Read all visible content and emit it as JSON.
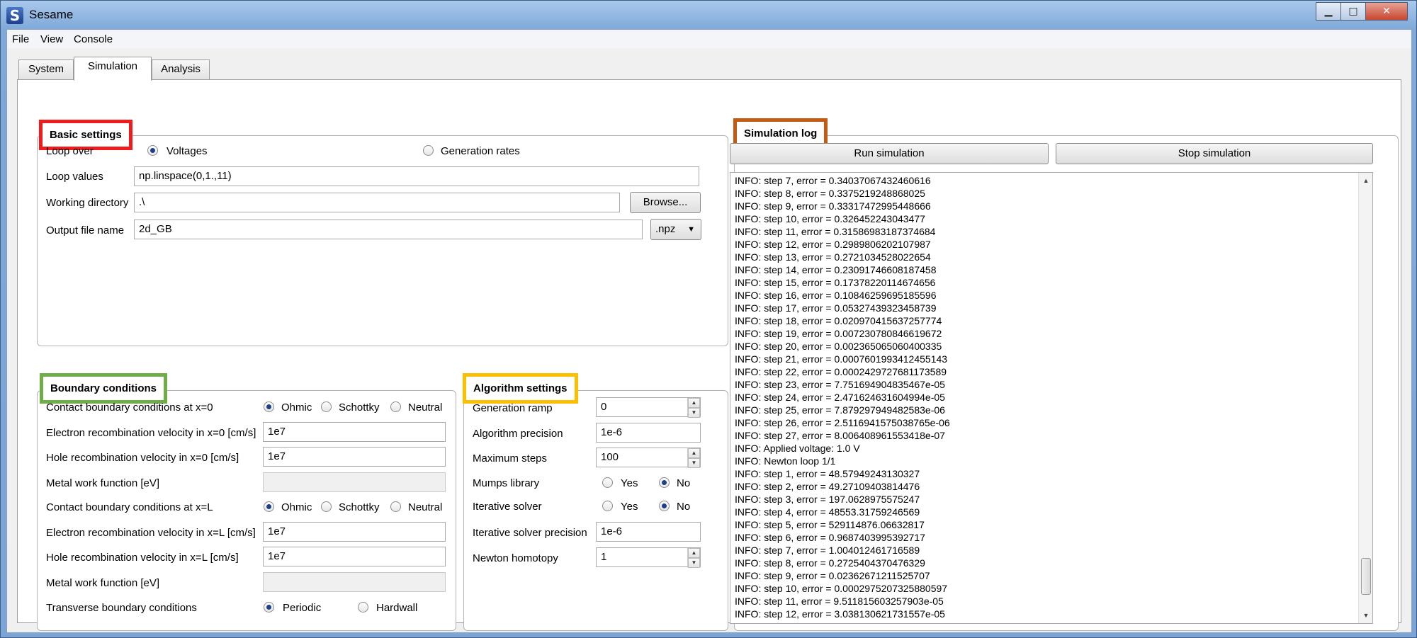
{
  "window": {
    "title": "Sesame",
    "icon_letter": "S",
    "minimize": "▁",
    "maximize": "□",
    "close": "✕"
  },
  "menu": [
    "File",
    "View",
    "Console"
  ],
  "tabs": [
    "System",
    "Simulation",
    "Analysis"
  ],
  "basic": {
    "title": "Basic settings",
    "loop_over": "Loop over",
    "opt_voltages": "Voltages",
    "opt_generation": "Generation rates",
    "loop_values_label": "Loop values",
    "loop_values": "np.linspace(0,1.,11)",
    "workdir_label": "Working directory",
    "workdir": ".\\",
    "browse": "Browse...",
    "output_label": "Output file name",
    "output": "2d_GB",
    "ext": ".npz"
  },
  "boundary": {
    "title": "Boundary conditions",
    "contact0": "Contact boundary conditions at x=0",
    "ohmic": "Ohmic",
    "schottky": "Schottky",
    "neutral": "Neutral",
    "erv0_label": "Electron recombination velocity in x=0 [cm/s]",
    "erv0": "1e7",
    "hrv0_label": "Hole recombination velocity in x=0 [cm/s]",
    "hrv0": "1e7",
    "metal_label": "Metal work function [eV]",
    "contactL": "Contact boundary conditions at x=L",
    "ervL_label": "Electron recombination velocity in x=L [cm/s]",
    "ervL": "1e7",
    "hrvL_label": "Hole recombination velocity in x=L [cm/s]",
    "hrvL": "1e7",
    "transverse": "Transverse boundary conditions",
    "periodic": "Periodic",
    "hardwall": "Hardwall"
  },
  "algorithm": {
    "title": "Algorithm settings",
    "gen_ramp_label": "Generation ramp",
    "gen_ramp": "0",
    "precision_label": "Algorithm precision",
    "precision": "1e-6",
    "max_steps_label": "Maximum steps",
    "max_steps": "100",
    "mumps_label": "Mumps library",
    "iter_label": "Iterative solver",
    "yes": "Yes",
    "no": "No",
    "iter_prec_label": "Iterative solver precision",
    "iter_prec": "1e-6",
    "homotopy_label": "Newton homotopy",
    "homotopy": "1"
  },
  "log": {
    "title": "Simulation log",
    "run": "Run simulation",
    "stop": "Stop simulation",
    "lines": [
      "INFO: step 7, error = 0.34037067432460616",
      "INFO: step 8, error = 0.3375219248868025",
      "INFO: step 9, error = 0.33317472995448666",
      "INFO: step 10, error = 0.326452243043477",
      "INFO: step 11, error = 0.31586983187374684",
      "INFO: step 12, error = 0.2989806202107987",
      "INFO: step 13, error = 0.2721034528022654",
      "INFO: step 14, error = 0.23091746608187458",
      "INFO: step 15, error = 0.17378220114674656",
      "INFO: step 16, error = 0.10846259695185596",
      "INFO: step 17, error = 0.05327439323458739",
      "INFO: step 18, error = 0.020970415637257774",
      "INFO: step 19, error = 0.007230780846619672",
      "INFO: step 20, error = 0.002365065060400335",
      "INFO: step 21, error = 0.0007601993412455143",
      "INFO: step 22, error = 0.0002429727681173589",
      "INFO: step 23, error = 7.751694904835467e-05",
      "INFO: step 24, error = 2.471624631604994e-05",
      "INFO: step 25, error = 7.879297949482583e-06",
      "INFO: step 26, error = 2.5116941575038765e-06",
      "INFO: step 27, error = 8.006408961553418e-07",
      "INFO: Applied voltage: 1.0 V",
      "INFO: Newton loop 1/1",
      "INFO: step 1, error = 48.57949243130327",
      "INFO: step 2, error = 49.27109403814476",
      "INFO: step 3, error = 197.0628975575247",
      "INFO: step 4, error = 48553.31759246569",
      "INFO: step 5, error = 529114876.06632817",
      "INFO: step 6, error = 0.9687403995392717",
      "INFO: step 7, error = 1.004012461716589",
      "INFO: step 8, error = 0.2725404370476329",
      "INFO: step 9, error = 0.02362671211525707",
      "INFO: step 10, error = 0.0002975207325880597",
      "INFO: step 11, error = 9.511815603257903e-05",
      "INFO: step 12, error = 3.038130621731557e-05"
    ]
  },
  "colors": {
    "basic": "#ee1c1c",
    "boundary": "#6fad47",
    "algorithm": "#fcbf00",
    "log": "#c55a11"
  }
}
